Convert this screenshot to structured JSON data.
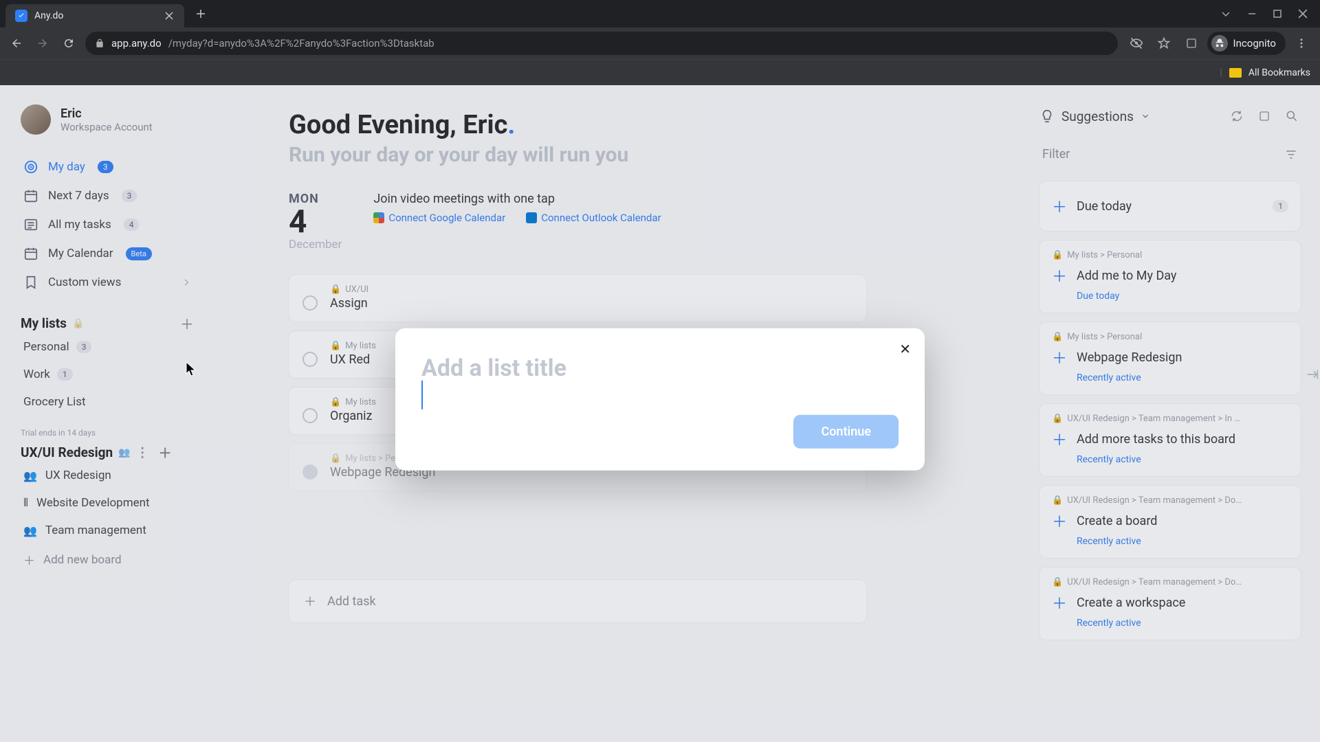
{
  "browser": {
    "tab_title": "Any.do",
    "url_host": "app.any.do",
    "url_path": "/myday?d=anydo%3A%2F%2Fanydo%3Faction%3Dtasktab",
    "incognito_label": "Incognito",
    "all_bookmarks": "All Bookmarks"
  },
  "profile": {
    "name": "Eric",
    "subtitle": "Workspace Account"
  },
  "nav": {
    "myday": {
      "label": "My day",
      "count": "3"
    },
    "next7": {
      "label": "Next 7 days",
      "count": "3"
    },
    "all": {
      "label": "All my tasks",
      "count": "4"
    },
    "calendar": {
      "label": "My Calendar",
      "badge": "Beta"
    },
    "custom": {
      "label": "Custom views"
    }
  },
  "mylists": {
    "title": "My lists",
    "items": [
      {
        "label": "Personal",
        "count": "3"
      },
      {
        "label": "Work",
        "count": "1"
      },
      {
        "label": "Grocery List",
        "count": ""
      }
    ]
  },
  "trial": "Trial ends in 14 days",
  "workspace": {
    "title": "UX/UI Redesign",
    "boards": [
      {
        "emoji": "👥",
        "label": "UX Redesign"
      },
      {
        "emoji": "⦀",
        "label": "Website Development"
      },
      {
        "emoji": "👥",
        "label": "Team management"
      }
    ],
    "add_board": "Add new board"
  },
  "main": {
    "greeting_pre": "Good Evening, ",
    "greeting_name": "Eric",
    "subtitle": "Run your day or your day will run you",
    "date": {
      "dow": "MON",
      "num": "4",
      "month": "December"
    },
    "join": "Join video meetings with one tap",
    "connect_google": "Connect Google Calendar",
    "connect_outlook": "Connect Outlook Calendar",
    "tasks": [
      {
        "path": "UX/UI",
        "title": "Assign",
        "done": false
      },
      {
        "path": "My lists",
        "title": "UX Red",
        "done": false
      },
      {
        "path": "My lists",
        "title": "Organiz",
        "done": false
      },
      {
        "path": "My lists > Personal",
        "title": "Webpage Redesign",
        "done": true
      }
    ],
    "add_task": "Add task"
  },
  "right": {
    "suggestions": "Suggestions",
    "filter": "Filter",
    "due_today": {
      "label": "Due today",
      "count": "1"
    },
    "cards": [
      {
        "path": "My lists > Personal",
        "title": "Add me to My Day",
        "tag": "Due today"
      },
      {
        "path": "My lists > Personal",
        "title": "Webpage Redesign",
        "tag": "Recently active"
      },
      {
        "path": "UX/UI Redesign > Team management > In …",
        "title": "Add more tasks to this board",
        "tag": "Recently active"
      },
      {
        "path": "UX/UI Redesign > Team management > Do…",
        "title": "Create a board",
        "tag": "Recently active"
      },
      {
        "path": "UX/UI Redesign > Team management > Do…",
        "title": "Create a workspace",
        "tag": "Recently active"
      }
    ]
  },
  "modal": {
    "placeholder": "Add a list title",
    "continue": "Continue"
  }
}
